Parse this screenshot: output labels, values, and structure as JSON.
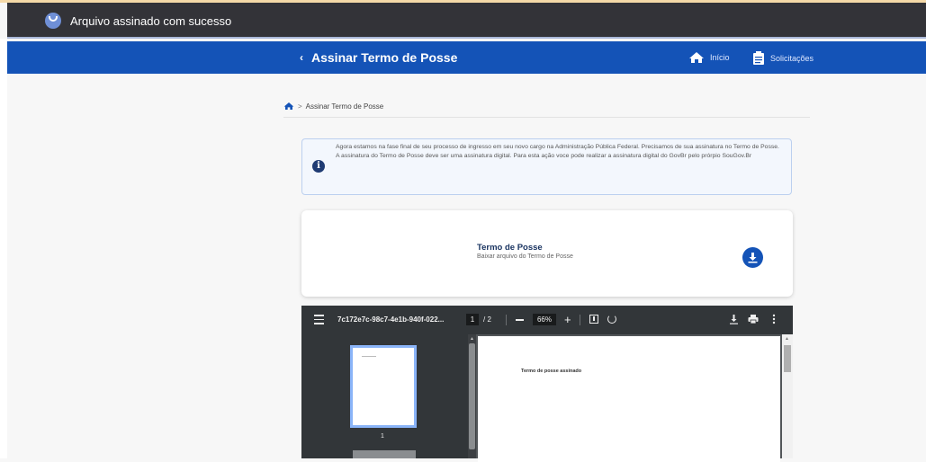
{
  "toast": {
    "message": "Arquivo assinado com sucesso",
    "icon": "check-smile-icon"
  },
  "navbar": {
    "back_symbol": "‹",
    "title": "Assinar Termo de Posse",
    "links": [
      {
        "label": "Início",
        "icon": "home-icon"
      },
      {
        "label": "Solicitações",
        "icon": "clipboard-icon"
      }
    ]
  },
  "breadcrumb": {
    "home_icon": "home-icon",
    "separator": ">",
    "current": "Assinar Termo de Posse"
  },
  "info": {
    "icon_text": "i",
    "lines": [
      "Agora estamos na fase final de seu processo de ingresso em seu novo cargo na Administração Pública Federal. Precisamos de sua assinatura no Termo de Posse.",
      "A assinatura do Termo de Posse deve ser uma assinatura digital. Para esta ação voce pode realizar a assinatura digital do GovBr pelo prórpio SouGov.Br"
    ]
  },
  "card": {
    "title": "Termo de Posse",
    "subtitle": "Baixar arquivo do Termo de Posse",
    "icon": "download-icon"
  },
  "pdf_viewer": {
    "filename": "7c172e7c-98c7-4e1b-940f-022...",
    "current_page": "1",
    "total_pages": "/ 2",
    "zoom": "66%",
    "thumbnail_number": "1",
    "page_text": "Termo de posse assinado",
    "colors": {
      "toolbar": "#323639",
      "background": "#525659",
      "thumb_border": "#8ab4f8"
    }
  },
  "colors": {
    "brand_blue": "#1453b7",
    "toast_bg": "#333338"
  }
}
